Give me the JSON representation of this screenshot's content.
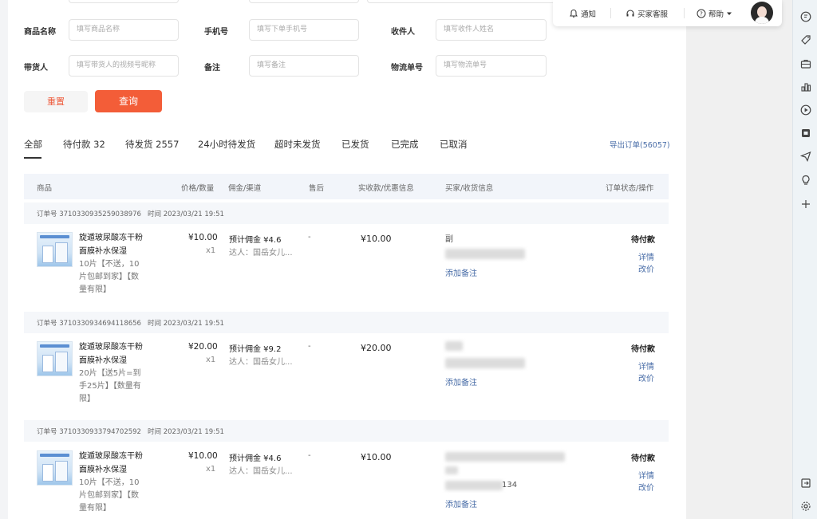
{
  "filters": {
    "row1": [
      {
        "label": "商品名称",
        "placeholder": "填写商品名称"
      },
      {
        "label": "手机号",
        "placeholder": "填写下单手机号"
      },
      {
        "label": "收件人",
        "placeholder": "填写收件人姓名"
      }
    ],
    "row2": [
      {
        "label": "带货人",
        "placeholder": "填写带货人的视频号昵称"
      },
      {
        "label": "备注",
        "placeholder": "填写备注"
      },
      {
        "label": "物流单号",
        "placeholder": "填写物流单号"
      }
    ],
    "reset_label": "重置",
    "query_label": "查询"
  },
  "tabs": [
    "全部",
    "待付款 32",
    "待发货 2557",
    "24小时待发货",
    "超时未发货",
    "已发货",
    "已完成",
    "已取消"
  ],
  "export_label": "导出订单(56057)",
  "table_headers": {
    "product": "商品",
    "price_qty": "价格/数量",
    "commission": "佣金/渠道",
    "after_sale": "售后",
    "paid": "实收款/优惠信息",
    "buyer": "买家/收货信息",
    "status": "订单状态/操作"
  },
  "orders": [
    {
      "order_no": "订单号 3710330935259038976",
      "time": "时间 2023/03/21 19:51",
      "name_lines": [
        "旋遁玻尿酸冻干粉",
        "面膜补水保湿"
      ],
      "spec_lines": [
        "10片【不送，10",
        "片包邮到家】【数",
        "量有限】"
      ],
      "price": "¥10.00",
      "qty": "x1",
      "commission": "预计佣金 ¥4.6",
      "channel": "达人：国岳女儿...",
      "after_sale": "-",
      "paid": "¥10.00",
      "buyer_lines": [
        "副"
      ],
      "note": "添加备注",
      "status": "待付款",
      "ops": [
        "详情",
        "改价"
      ]
    },
    {
      "order_no": "订单号 3710330934694118656",
      "time": "时间 2023/03/21 19:51",
      "name_lines": [
        "旋遁玻尿酸冻干粉",
        "面膜补水保湿"
      ],
      "spec_lines": [
        "20片【送5片=到",
        "手25片】【数量有",
        "限】"
      ],
      "price": "¥20.00",
      "qty": "x1",
      "commission": "预计佣金 ¥9.2",
      "channel": "达人：国岳女儿...",
      "after_sale": "-",
      "paid": "¥20.00",
      "buyer_lines": [],
      "note": "添加备注",
      "status": "待付款",
      "ops": [
        "详情",
        "改价"
      ]
    },
    {
      "order_no": "订单号 3710330933794702592",
      "time": "时间 2023/03/21 19:51",
      "name_lines": [
        "旋遁玻尿酸冻干粉",
        "面膜补水保湿"
      ],
      "spec_lines": [
        "10片【不送，10",
        "片包邮到家】【数",
        "量有限】"
      ],
      "price": "¥10.00",
      "qty": "x1",
      "commission": "预计佣金 ¥4.6",
      "channel": "达人：国岳女儿...",
      "after_sale": "-",
      "paid": "¥10.00",
      "buyer_lines": [
        "134"
      ],
      "note": "添加备注",
      "status": "待付款",
      "ops": [
        "详情",
        "改价"
      ]
    }
  ],
  "topbar": {
    "notify": "通知",
    "service": "买家客服",
    "help": "帮助"
  },
  "icons": {
    "rail": [
      "chat-icon",
      "tag-icon",
      "briefcase-icon",
      "chart-icon",
      "play-icon",
      "shop-icon",
      "send-icon",
      "bulb-icon",
      "plus-icon",
      "exit-icon",
      "settings-icon"
    ]
  },
  "colors": {
    "accent": "#f35d38",
    "link": "#4a6ea8"
  }
}
